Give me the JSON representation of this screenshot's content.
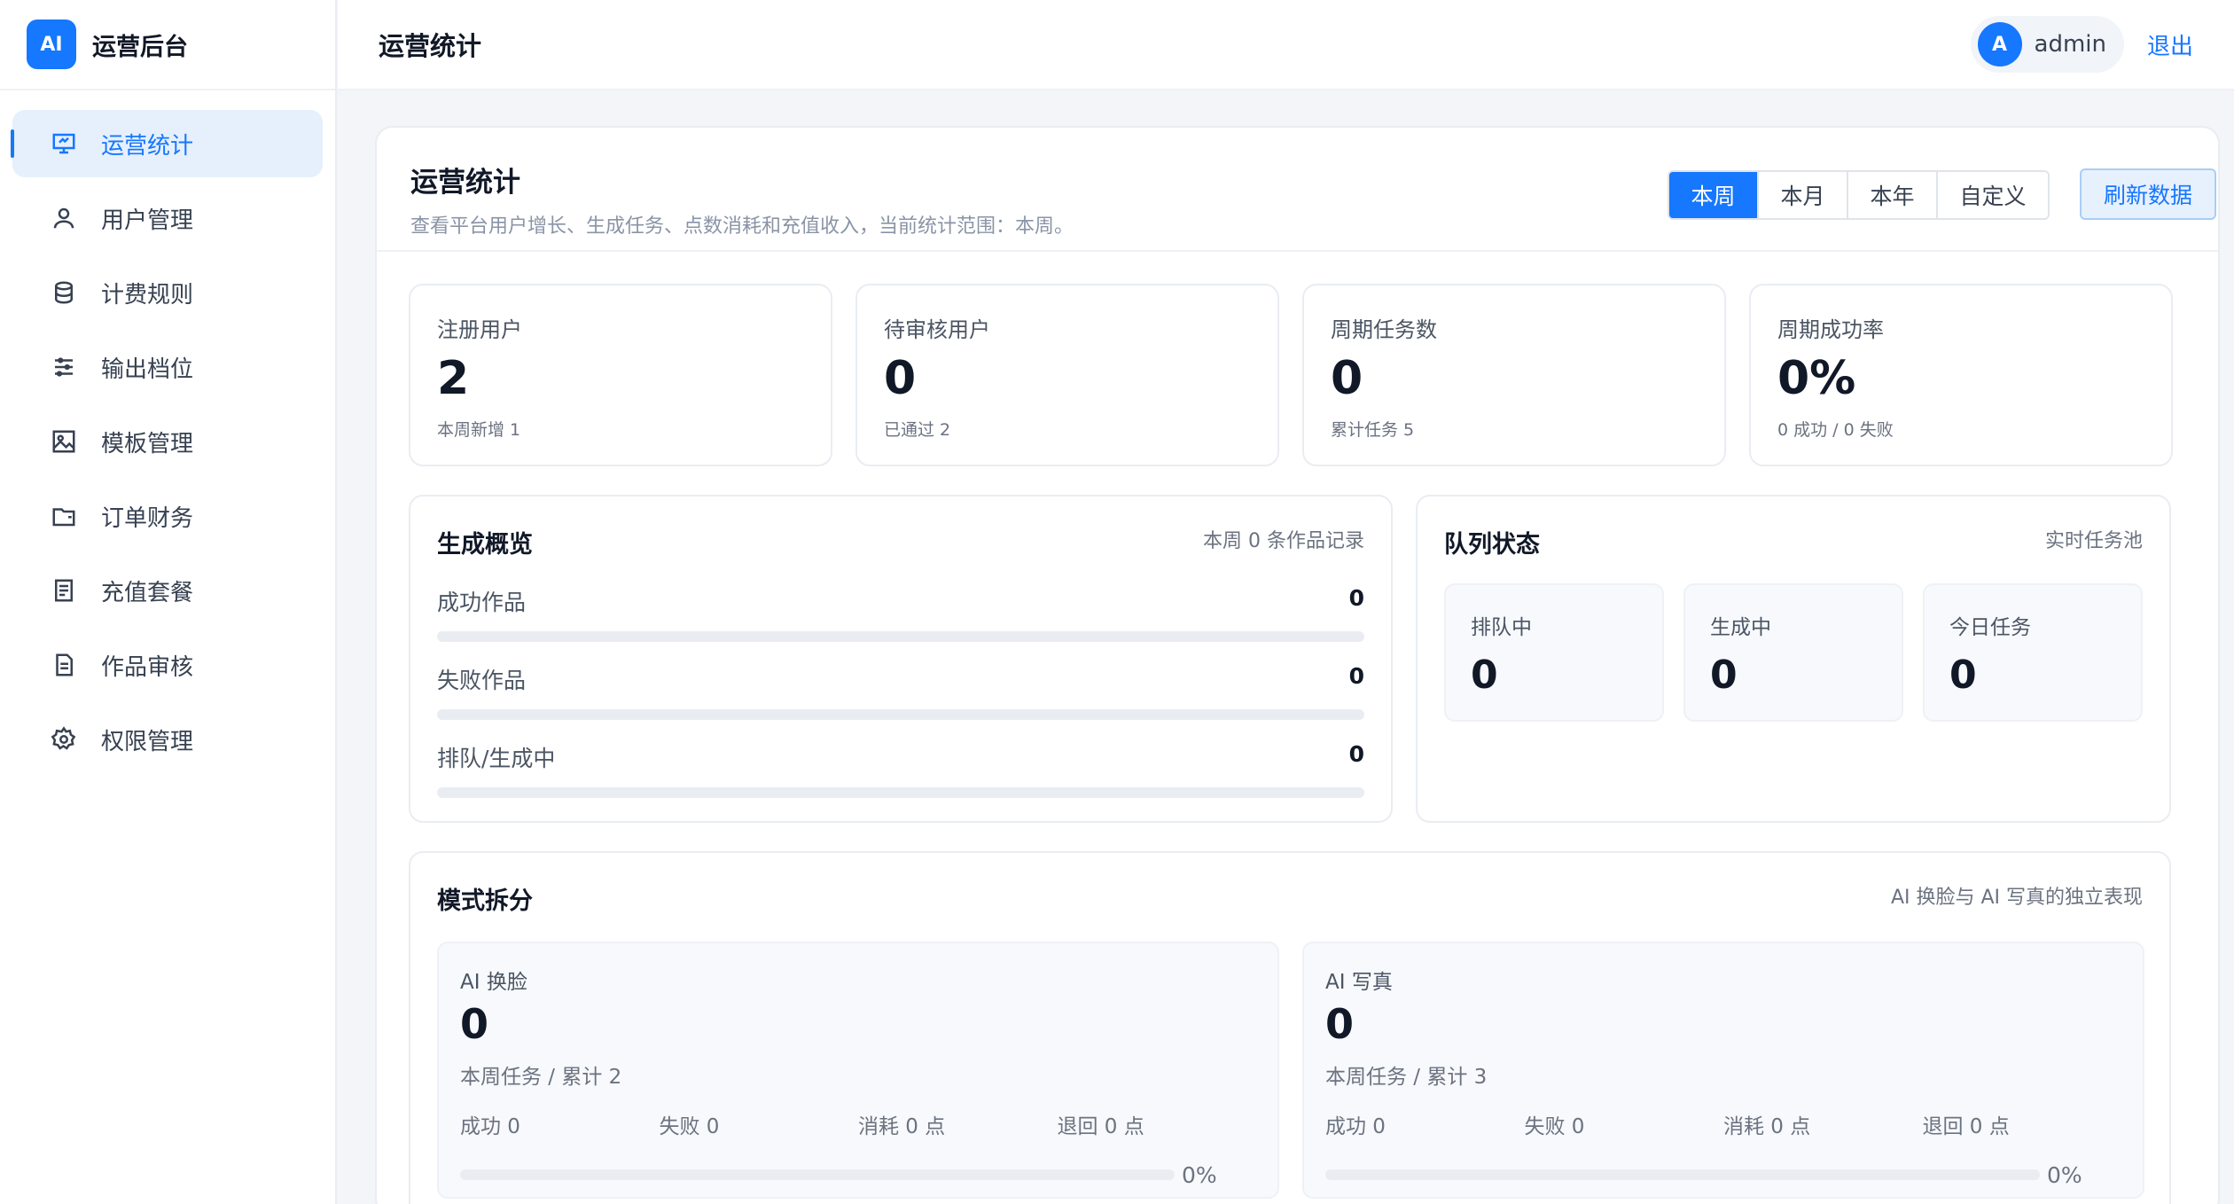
{
  "brand": {
    "logo": "AI",
    "name": "运营后台"
  },
  "sidebar": {
    "items": [
      {
        "label": "运营统计",
        "icon": "presentation-icon",
        "active": true
      },
      {
        "label": "用户管理",
        "icon": "user-icon"
      },
      {
        "label": "计费规则",
        "icon": "database-icon"
      },
      {
        "label": "输出档位",
        "icon": "sliders-icon"
      },
      {
        "label": "模板管理",
        "icon": "image-icon"
      },
      {
        "label": "订单财务",
        "icon": "wallet-icon"
      },
      {
        "label": "充值套餐",
        "icon": "receipt-icon"
      },
      {
        "label": "作品审核",
        "icon": "document-icon"
      },
      {
        "label": "权限管理",
        "icon": "gear-icon"
      }
    ]
  },
  "header": {
    "title": "运营统计",
    "avatar": "A",
    "username": "admin",
    "logout": "退出"
  },
  "panel": {
    "title": "运营统计",
    "description": "查看平台用户增长、生成任务、点数消耗和充值收入，当前统计范围：本周。",
    "ranges": [
      "本周",
      "本月",
      "本年",
      "自定义"
    ],
    "active_range": "本周",
    "refresh": "刷新数据"
  },
  "stats": [
    {
      "label": "注册用户",
      "value": "2",
      "sub": "本周新增 1"
    },
    {
      "label": "待审核用户",
      "value": "0",
      "sub": "已通过 2"
    },
    {
      "label": "周期任务数",
      "value": "0",
      "sub": "累计任务 5"
    },
    {
      "label": "周期成功率",
      "value": "0%",
      "sub": "0 成功 / 0 失败"
    }
  ],
  "overview": {
    "title": "生成概览",
    "note": "本周 0 条作品记录",
    "rows": [
      {
        "label": "成功作品",
        "value": "0",
        "fraction": 0
      },
      {
        "label": "失败作品",
        "value": "0",
        "fraction": 0
      },
      {
        "label": "排队/生成中",
        "value": "0",
        "fraction": 0
      }
    ]
  },
  "queue": {
    "title": "队列状态",
    "note": "实时任务池",
    "boxes": [
      {
        "label": "排队中",
        "value": "0"
      },
      {
        "label": "生成中",
        "value": "0"
      },
      {
        "label": "今日任务",
        "value": "0"
      }
    ]
  },
  "modes": {
    "title": "模式拆分",
    "note": "AI 换脸与 AI 写真的独立表现",
    "items": [
      {
        "name": "AI 换脸",
        "value": "0",
        "sub": "本周任务 / 累计 2",
        "success": "成功 0",
        "fail": "失败 0",
        "consume": "消耗 0 点",
        "refund": "退回 0 点",
        "percent": "0%",
        "fraction": 0
      },
      {
        "name": "AI 写真",
        "value": "0",
        "sub": "本周任务 / 累计 3",
        "success": "成功 0",
        "fail": "失败 0",
        "consume": "消耗 0 点",
        "refund": "退回 0 点",
        "percent": "0%",
        "fraction": 0
      }
    ]
  },
  "colors": {
    "accent": "#1677ff",
    "active_bg": "#e6f0fc"
  }
}
